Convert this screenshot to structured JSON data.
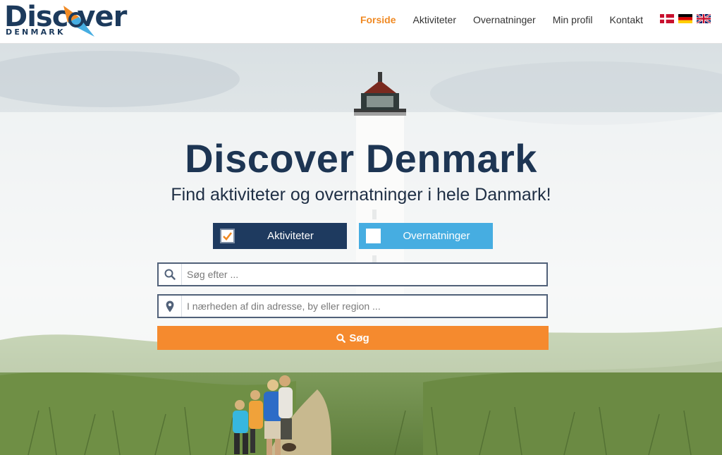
{
  "brand": {
    "logo_word": "Disc    ver",
    "logo_sub": "DENMARK",
    "colors": {
      "navy": "#1d3553",
      "orange": "#f08a24",
      "blue": "#46ade1"
    }
  },
  "nav": {
    "items": [
      {
        "label": "Forside",
        "active": true
      },
      {
        "label": "Aktiviteter",
        "active": false
      },
      {
        "label": "Overnatninger",
        "active": false
      },
      {
        "label": "Min profil",
        "active": false
      },
      {
        "label": "Kontakt",
        "active": false
      }
    ],
    "languages": [
      "danish-flag-icon",
      "german-flag-icon",
      "uk-flag-icon"
    ]
  },
  "hero": {
    "title": "Discover Denmark",
    "subtitle": "Find aktiviteter og overnatninger i hele Danmark!"
  },
  "toggles": {
    "activities": {
      "label": "Aktiviteter",
      "checked": true
    },
    "accommodations": {
      "label": "Overnatninger",
      "checked": false
    }
  },
  "search": {
    "query_placeholder": "Søg efter ...",
    "query_value": "",
    "location_placeholder": "I nærheden af din adresse, by eller region ...",
    "location_value": "",
    "button_label": "Søg",
    "icons": [
      "search-icon",
      "map-marker-icon"
    ]
  }
}
